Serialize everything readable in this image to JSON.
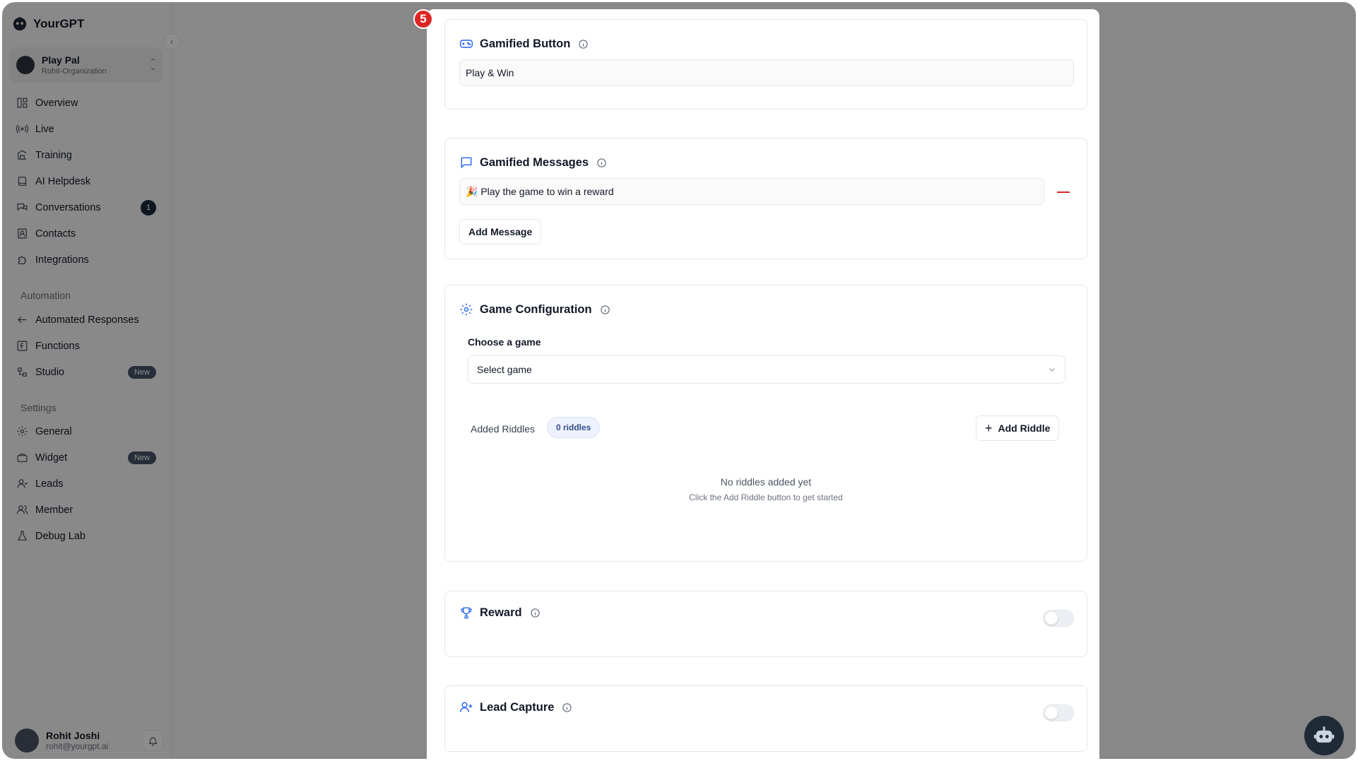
{
  "sidebar": {
    "brand": "YourGPT",
    "workspace": {
      "name": "Play Pal",
      "org": "Rohit-Organization"
    },
    "main_items": [
      {
        "label": "Overview",
        "icon": "layout-icon"
      },
      {
        "label": "Live",
        "icon": "broadcast-icon"
      },
      {
        "label": "Training",
        "icon": "training-icon"
      },
      {
        "label": "AI Helpdesk",
        "icon": "book-icon"
      },
      {
        "label": "Conversations",
        "icon": "chat-icon",
        "count": "1"
      },
      {
        "label": "Contacts",
        "icon": "contacts-icon"
      },
      {
        "label": "Integrations",
        "icon": "puzzle-icon"
      }
    ],
    "automation_label": "Automation",
    "automation_items": [
      {
        "label": "Automated Responses",
        "icon": "reply-icon"
      },
      {
        "label": "Functions",
        "icon": "function-icon"
      },
      {
        "label": "Studio",
        "icon": "studio-icon",
        "badge": "New"
      }
    ],
    "settings_label": "Settings",
    "settings_items": [
      {
        "label": "General",
        "icon": "gear-icon"
      },
      {
        "label": "Widget",
        "icon": "widget-icon",
        "badge": "New"
      },
      {
        "label": "Leads",
        "icon": "user-icon"
      },
      {
        "label": "Member",
        "icon": "users-icon"
      },
      {
        "label": "Debug Lab",
        "icon": "flask-icon"
      }
    ],
    "user": {
      "name": "Rohit Joshi",
      "email": "rohit@yourgpt.ai"
    }
  },
  "modal": {
    "step": "5",
    "gamified_button": {
      "title": "Gamified Button",
      "value": "Play & Win"
    },
    "gamified_messages": {
      "title": "Gamified Messages",
      "messages": [
        "🎉 Play the game to win a reward"
      ],
      "add_label": "Add Message"
    },
    "game_config": {
      "title": "Game Configuration",
      "choose_label": "Choose a game",
      "select_placeholder": "Select game",
      "riddles_label": "Added Riddles",
      "riddles_count": "0 riddles",
      "add_riddle_label": "Add Riddle",
      "empty_title": "No riddles added yet",
      "empty_sub": "Click the Add Riddle button to get started"
    },
    "reward": {
      "title": "Reward",
      "enabled": false
    },
    "lead_capture": {
      "title": "Lead Capture",
      "enabled": false
    }
  },
  "colors": {
    "accent": "#2563eb",
    "danger": "#dc2626",
    "overlay": "rgba(0,0,0,0.45)"
  }
}
